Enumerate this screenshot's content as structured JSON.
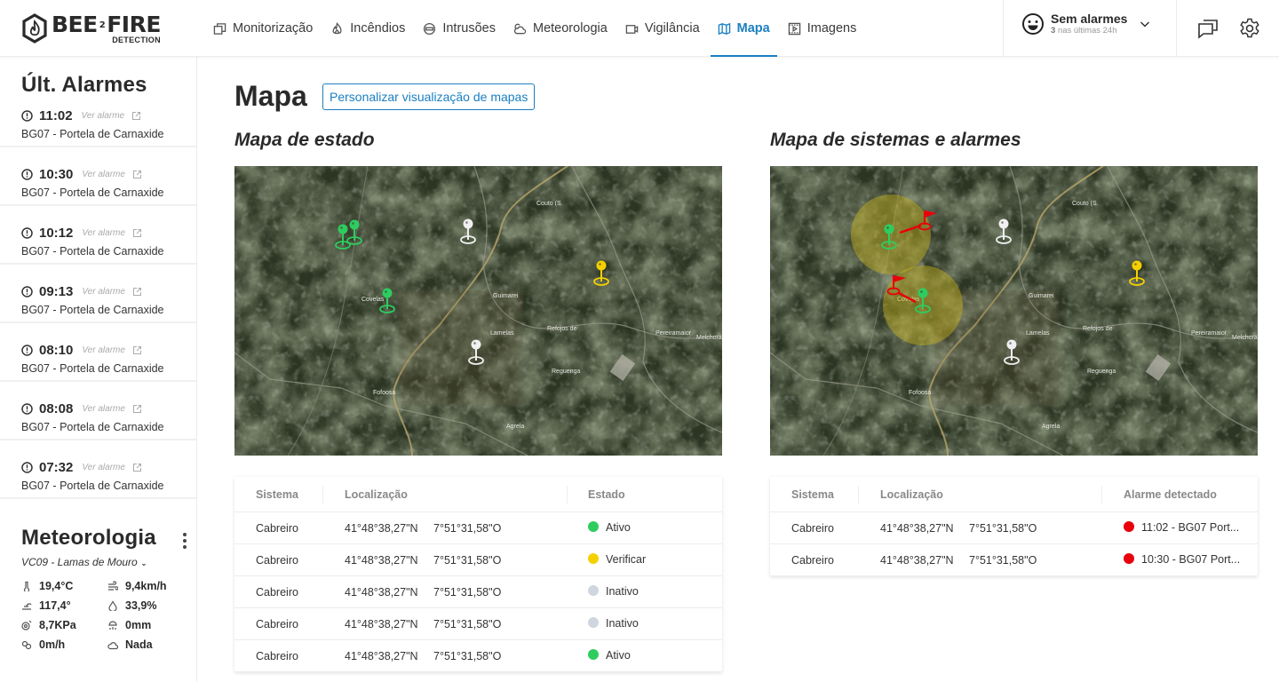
{
  "header": {
    "logo": {
      "main": "BEE",
      "mid": "2",
      "fire": "FIRE",
      "sub": "DETECTION"
    },
    "nav": [
      {
        "label": "Monitorização",
        "icon": "windows-icon",
        "active": false
      },
      {
        "label": "Incêndios",
        "icon": "fire-icon",
        "active": false
      },
      {
        "label": "Intrusões",
        "icon": "no-entry-icon",
        "active": false
      },
      {
        "label": "Meteorologia",
        "icon": "cloud-sun-icon",
        "active": false
      },
      {
        "label": "Vigilância",
        "icon": "camera-icon",
        "active": false
      },
      {
        "label": "Mapa",
        "icon": "map-icon",
        "active": true
      },
      {
        "label": "Imagens",
        "icon": "film-icon",
        "active": false
      }
    ],
    "alarm_status": {
      "title": "Sem alarmes",
      "count": "3",
      "count_suffix": "nas últimas 24h"
    },
    "accent_color": "#1a7fc1"
  },
  "sidebar": {
    "title": "Últ. Alarmes",
    "view_label": "Ver alarme",
    "alarms": [
      {
        "time": "11:02",
        "location": "BG07 - Portela de Carnaxide"
      },
      {
        "time": "10:30",
        "location": "BG07 - Portela de Carnaxide"
      },
      {
        "time": "10:12",
        "location": "BG07 - Portela de Carnaxide"
      },
      {
        "time": "09:13",
        "location": "BG07 - Portela de Carnaxide"
      },
      {
        "time": "08:10",
        "location": "BG07 - Portela de Carnaxide"
      },
      {
        "time": "08:08",
        "location": "BG07 - Portela de Carnaxide"
      },
      {
        "time": "07:32",
        "location": "BG07 - Portela de Carnaxide"
      }
    ],
    "meteo": {
      "title": "Meteorologia",
      "station": "VC09 - Lamas de Mouro",
      "readings": [
        {
          "icon": "thermometer-icon",
          "value": "19,4°C"
        },
        {
          "icon": "wind-icon",
          "value": "9,4km/h"
        },
        {
          "icon": "wind-direction-icon",
          "value": "117,4°"
        },
        {
          "icon": "humidity-icon",
          "value": "33,9%"
        },
        {
          "icon": "pressure-icon",
          "value": "8,7KPa"
        },
        {
          "icon": "rain-icon",
          "value": "0mm"
        },
        {
          "icon": "rain-rate-icon",
          "value": "0m/h"
        },
        {
          "icon": "cloud-icon",
          "value": "Nada"
        }
      ]
    }
  },
  "main": {
    "title": "Mapa",
    "customize_button": "Personalizar visualização de mapas",
    "status_map": {
      "title": "Mapa de estado",
      "map_labels": [
        "Covelas",
        "Guimarei",
        "Lamelas",
        "Refojos de Riba de Ave",
        "Reguenga",
        "Fofoosa",
        "Agrela",
        "Couto (S. Miguel)",
        "Pereiramaior",
        "Melchora"
      ],
      "table": {
        "headers": [
          "Sistema",
          "Localização",
          "Estado"
        ],
        "rows": [
          {
            "system": "Cabreiro",
            "lat": "41°48°38,27\"N",
            "lon": "7°51°31,58\"O",
            "status": "Ativo",
            "color": "#2ecc5f"
          },
          {
            "system": "Cabreiro",
            "lat": "41°48°38,27\"N",
            "lon": "7°51°31,58\"O",
            "status": "Verificar",
            "color": "#f5d000"
          },
          {
            "system": "Cabreiro",
            "lat": "41°48°38,27\"N",
            "lon": "7°51°31,58\"O",
            "status": "Inativo",
            "color": "#cfd6de"
          },
          {
            "system": "Cabreiro",
            "lat": "41°48°38,27\"N",
            "lon": "7°51°31,58\"O",
            "status": "Inativo",
            "color": "#cfd6de"
          },
          {
            "system": "Cabreiro",
            "lat": "41°48°38,27\"N",
            "lon": "7°51°31,58\"O",
            "status": "Ativo",
            "color": "#2ecc5f"
          }
        ]
      }
    },
    "alarms_map": {
      "title": "Mapa de sistemas e alarmes",
      "table": {
        "headers": [
          "Sistema",
          "Localização",
          "Alarme detectado"
        ],
        "rows": [
          {
            "system": "Cabreiro",
            "lat": "41°48°38,27\"N",
            "lon": "7°51°31,58\"O",
            "alarm": "11:02 - BG07 Port...",
            "color": "#e8000b"
          },
          {
            "system": "Cabreiro",
            "lat": "41°48°38,27\"N",
            "lon": "7°51°31,58\"O",
            "alarm": "10:30 - BG07 Port...",
            "color": "#e8000b"
          }
        ]
      }
    }
  }
}
